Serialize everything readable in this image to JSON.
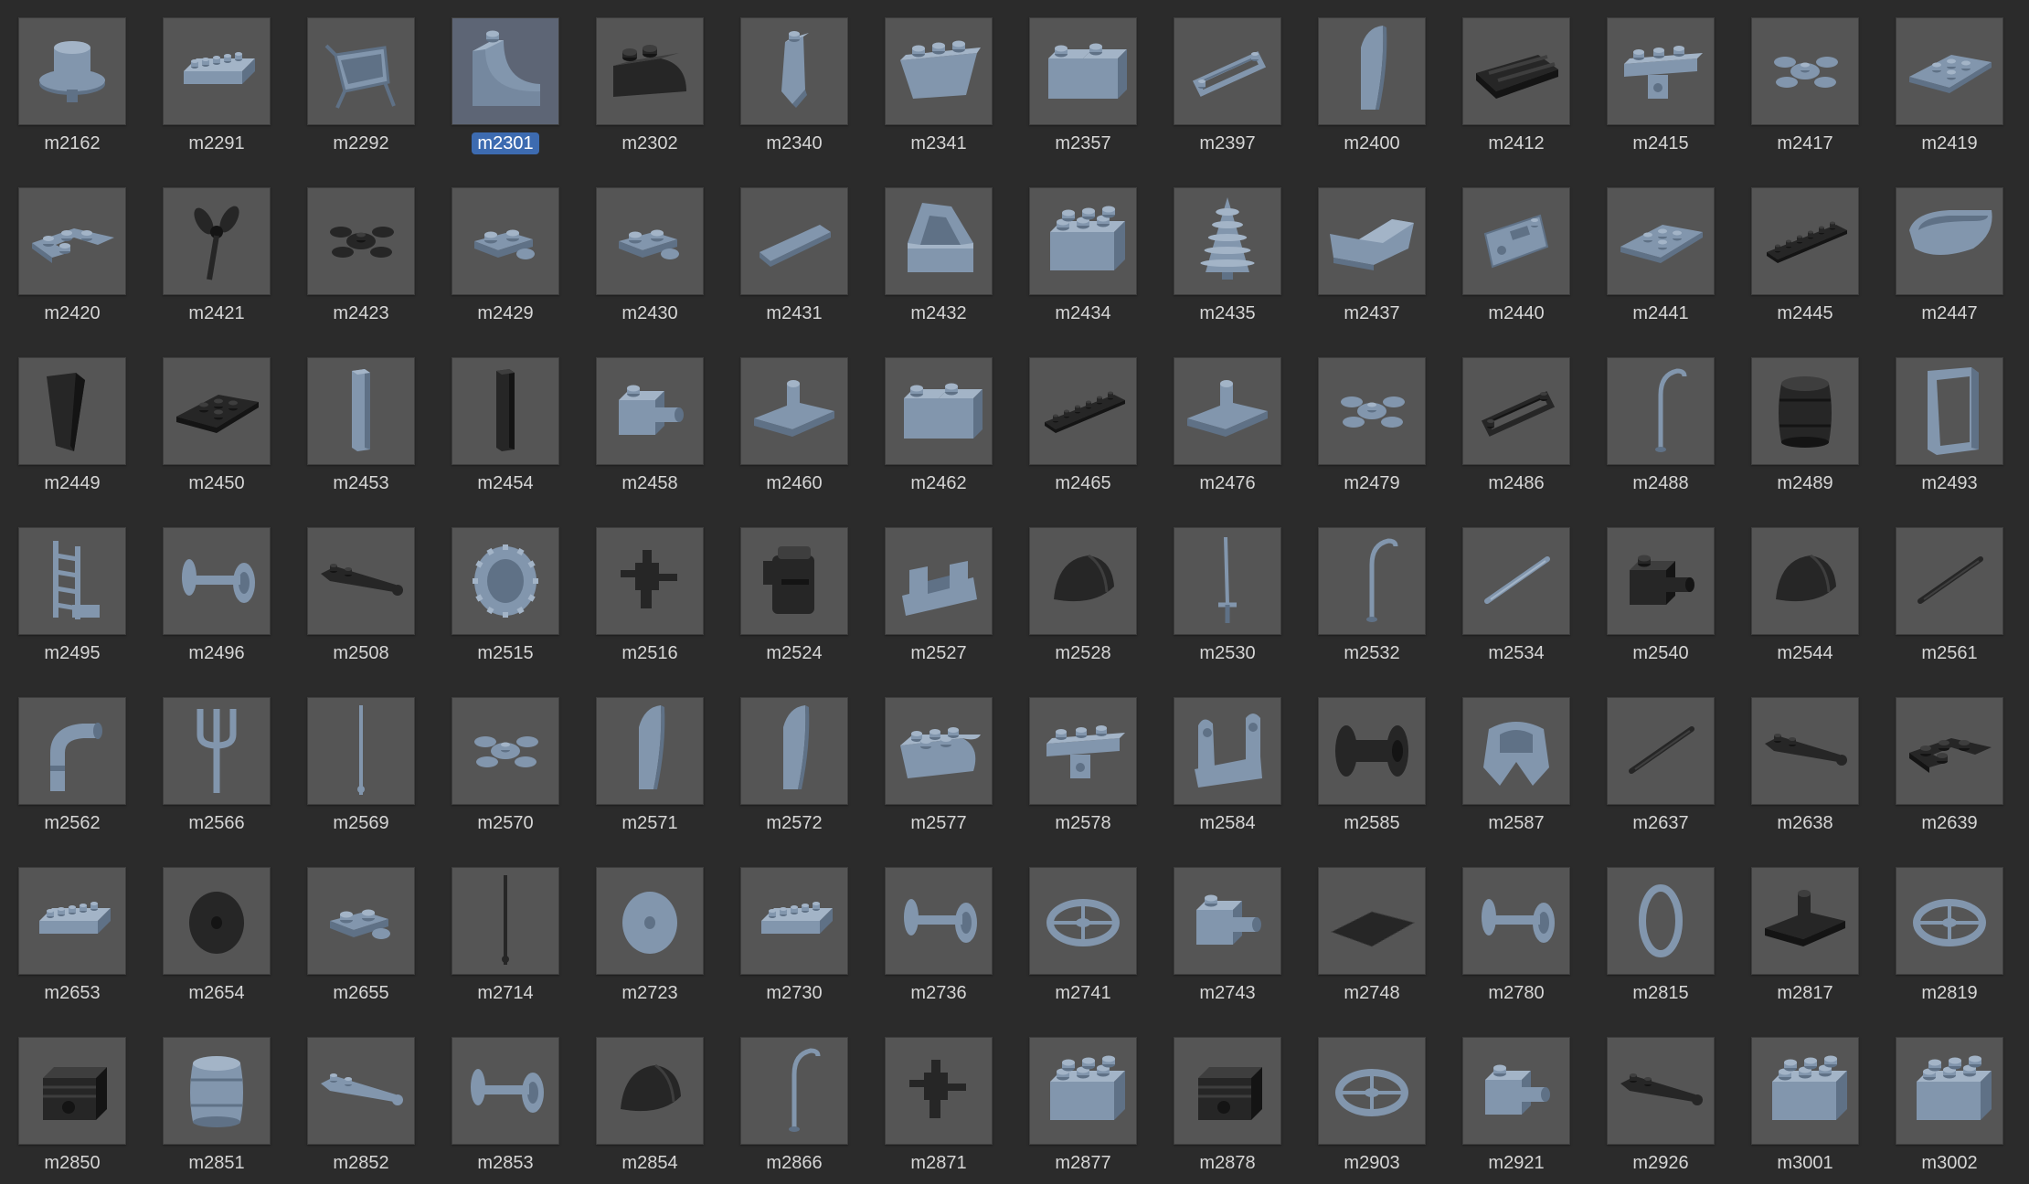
{
  "browser": {
    "selected": "m2301",
    "colors": {
      "background": "#2b2b2b",
      "tile": "#555555",
      "selected_tile": "#5d6575",
      "selection_accent": "#3d6bb0",
      "part_blue": "#8296ad",
      "part_black": "#1e1e1e"
    },
    "items": [
      {
        "label": "m2162",
        "shape": "hat",
        "color": "blue"
      },
      {
        "label": "m2291",
        "shape": "long-brick",
        "color": "blue"
      },
      {
        "label": "m2292",
        "shape": "wheelbarrow",
        "color": "blue"
      },
      {
        "label": "m2301",
        "shape": "curved-slope",
        "color": "blue"
      },
      {
        "label": "m2302",
        "shape": "curved-brick",
        "color": "black"
      },
      {
        "label": "m2340",
        "shape": "tail",
        "color": "blue"
      },
      {
        "label": "m2341",
        "shape": "inverted-slope",
        "color": "blue"
      },
      {
        "label": "m2357",
        "shape": "corner-brick",
        "color": "blue"
      },
      {
        "label": "m2397",
        "shape": "frame",
        "color": "blue"
      },
      {
        "label": "m2400",
        "shape": "blade",
        "color": "blue"
      },
      {
        "label": "m2412",
        "shape": "grille",
        "color": "black"
      },
      {
        "label": "m2415",
        "shape": "hinge-plate",
        "color": "blue"
      },
      {
        "label": "m2417",
        "shape": "leaves",
        "color": "blue"
      },
      {
        "label": "m2419",
        "shape": "wedge-plate",
        "color": "blue"
      },
      {
        "label": "m2420",
        "shape": "corner-plate",
        "color": "blue"
      },
      {
        "label": "m2421",
        "shape": "propeller",
        "color": "black"
      },
      {
        "label": "m2423",
        "shape": "leaves",
        "color": "black"
      },
      {
        "label": "m2429",
        "shape": "hinge",
        "color": "blue"
      },
      {
        "label": "m2430",
        "shape": "hinge",
        "color": "blue"
      },
      {
        "label": "m2431",
        "shape": "tile",
        "color": "blue"
      },
      {
        "label": "m2432",
        "shape": "handle",
        "color": "blue"
      },
      {
        "label": "m2434",
        "shape": "big-brick",
        "color": "blue"
      },
      {
        "label": "m2435",
        "shape": "tree",
        "color": "blue"
      },
      {
        "label": "m2437",
        "shape": "windscreen",
        "color": "blue"
      },
      {
        "label": "m2440",
        "shape": "panel",
        "color": "blue"
      },
      {
        "label": "m2441",
        "shape": "wedge-plate",
        "color": "blue"
      },
      {
        "label": "m2445",
        "shape": "long-plate",
        "color": "black"
      },
      {
        "label": "m2447",
        "shape": "visor",
        "color": "blue"
      },
      {
        "label": "m2449",
        "shape": "tall-slope",
        "color": "black"
      },
      {
        "label": "m2450",
        "shape": "wedge-plate",
        "color": "black"
      },
      {
        "label": "m2453",
        "shape": "pillar",
        "color": "blue"
      },
      {
        "label": "m2454",
        "shape": "pillar",
        "color": "black"
      },
      {
        "label": "m2458",
        "shape": "pin-brick",
        "color": "blue"
      },
      {
        "label": "m2460",
        "shape": "plate-pin",
        "color": "blue"
      },
      {
        "label": "m2462",
        "shape": "corner-brick",
        "color": "blue"
      },
      {
        "label": "m2465",
        "shape": "long-plate",
        "color": "black"
      },
      {
        "label": "m2476",
        "shape": "plate-pin",
        "color": "blue"
      },
      {
        "label": "m2479",
        "shape": "leaves",
        "color": "blue"
      },
      {
        "label": "m2486",
        "shape": "frame",
        "color": "black"
      },
      {
        "label": "m2488",
        "shape": "lamp",
        "color": "blue"
      },
      {
        "label": "m2489",
        "shape": "barrel",
        "color": "black"
      },
      {
        "label": "m2493",
        "shape": "window",
        "color": "blue"
      },
      {
        "label": "m2495",
        "shape": "ladder",
        "color": "blue"
      },
      {
        "label": "m2496",
        "shape": "axle",
        "color": "blue"
      },
      {
        "label": "m2508",
        "shape": "lever",
        "color": "black"
      },
      {
        "label": "m2515",
        "shape": "tire",
        "color": "blue"
      },
      {
        "label": "m2516",
        "shape": "tool",
        "color": "black"
      },
      {
        "label": "m2524",
        "shape": "backpack",
        "color": "black"
      },
      {
        "label": "m2527",
        "shape": "cannon",
        "color": "blue"
      },
      {
        "label": "m2528",
        "shape": "cap",
        "color": "black"
      },
      {
        "label": "m2530",
        "shape": "sword",
        "color": "blue"
      },
      {
        "label": "m2532",
        "shape": "lamp",
        "color": "blue"
      },
      {
        "label": "m2534",
        "shape": "rod",
        "color": "blue"
      },
      {
        "label": "m2540",
        "shape": "pin-brick",
        "color": "black"
      },
      {
        "label": "m2544",
        "shape": "cap",
        "color": "black"
      },
      {
        "label": "m2561",
        "shape": "rod",
        "color": "black"
      },
      {
        "label": "m2562",
        "shape": "pipe",
        "color": "blue"
      },
      {
        "label": "m2566",
        "shape": "trident",
        "color": "blue"
      },
      {
        "label": "m2569",
        "shape": "antenna",
        "color": "blue"
      },
      {
        "label": "m2570",
        "shape": "leaves",
        "color": "blue"
      },
      {
        "label": "m2571",
        "shape": "blade",
        "color": "blue"
      },
      {
        "label": "m2572",
        "shape": "blade",
        "color": "blue"
      },
      {
        "label": "m2577",
        "shape": "round-brick",
        "color": "blue"
      },
      {
        "label": "m2578",
        "shape": "hinge-plate",
        "color": "blue"
      },
      {
        "label": "m2584",
        "shape": "bracket",
        "color": "blue"
      },
      {
        "label": "m2585",
        "shape": "spool",
        "color": "black"
      },
      {
        "label": "m2587",
        "shape": "armor",
        "color": "blue"
      },
      {
        "label": "m2637",
        "shape": "rod",
        "color": "black"
      },
      {
        "label": "m2638",
        "shape": "lever",
        "color": "black"
      },
      {
        "label": "m2639",
        "shape": "corner-plate",
        "color": "black"
      },
      {
        "label": "m2653",
        "shape": "long-brick",
        "color": "blue"
      },
      {
        "label": "m2654",
        "shape": "disk",
        "color": "black"
      },
      {
        "label": "m2655",
        "shape": "hinge",
        "color": "blue"
      },
      {
        "label": "m2714",
        "shape": "antenna",
        "color": "black"
      },
      {
        "label": "m2723",
        "shape": "disk",
        "color": "blue"
      },
      {
        "label": "m2730",
        "shape": "long-brick",
        "color": "blue"
      },
      {
        "label": "m2736",
        "shape": "axle",
        "color": "blue"
      },
      {
        "label": "m2741",
        "shape": "wheel",
        "color": "blue"
      },
      {
        "label": "m2743",
        "shape": "pin-brick",
        "color": "blue"
      },
      {
        "label": "m2748",
        "shape": "mesh",
        "color": "black"
      },
      {
        "label": "m2780",
        "shape": "axle",
        "color": "blue"
      },
      {
        "label": "m2815",
        "shape": "ring",
        "color": "blue"
      },
      {
        "label": "m2817",
        "shape": "plate-pin",
        "color": "black"
      },
      {
        "label": "m2819",
        "shape": "wheel",
        "color": "blue"
      },
      {
        "label": "m2850",
        "shape": "engine",
        "color": "black"
      },
      {
        "label": "m2851",
        "shape": "barrel",
        "color": "blue"
      },
      {
        "label": "m2852",
        "shape": "lever",
        "color": "blue"
      },
      {
        "label": "m2853",
        "shape": "axle",
        "color": "blue"
      },
      {
        "label": "m2854",
        "shape": "cap",
        "color": "black"
      },
      {
        "label": "m2866",
        "shape": "lamp",
        "color": "blue"
      },
      {
        "label": "m2871",
        "shape": "tool",
        "color": "black"
      },
      {
        "label": "m2877",
        "shape": "big-brick",
        "color": "blue"
      },
      {
        "label": "m2878",
        "shape": "engine",
        "color": "black"
      },
      {
        "label": "m2903",
        "shape": "wheel",
        "color": "blue"
      },
      {
        "label": "m2921",
        "shape": "pin-brick",
        "color": "blue"
      },
      {
        "label": "m2926",
        "shape": "lever",
        "color": "black"
      },
      {
        "label": "m3001",
        "shape": "big-brick",
        "color": "blue"
      },
      {
        "label": "m3002",
        "shape": "big-brick",
        "color": "blue"
      }
    ]
  }
}
